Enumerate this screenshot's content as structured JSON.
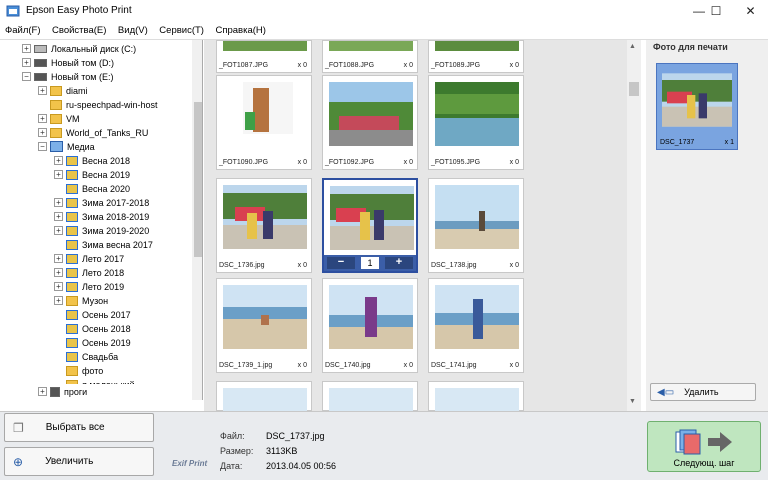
{
  "window": {
    "title": "Epson Easy Photo Print",
    "minimize": "—",
    "maximize": "☐",
    "close": "✕"
  },
  "menu": [
    "Файл(F)",
    "Свойства(E)",
    "Вид(V)",
    "Сервис(T)",
    "Справка(H)"
  ],
  "tree": [
    {
      "label": "Локальный диск (C:)",
      "icon": "drive-icon"
    },
    {
      "label": "Новый том (D:)",
      "icon": "drive-icon"
    },
    {
      "label": "Новый том (E:)",
      "icon": "drive-icon"
    },
    {
      "label": "diami",
      "icon": "folder-icon"
    },
    {
      "label": "ru-speechpad-win-host",
      "icon": "folder-icon"
    },
    {
      "label": "VM",
      "icon": "folder-icon"
    },
    {
      "label": "World_of_Tanks_RU",
      "icon": "folder-icon"
    },
    {
      "label": "Медиа",
      "icon": "media-folder-icon"
    },
    {
      "label": "Весна 2018",
      "icon": "folder-icon"
    },
    {
      "label": "Весна 2019",
      "icon": "folder-icon"
    },
    {
      "label": "Весна 2020",
      "icon": "folder-icon"
    },
    {
      "label": "Зима 2017-2018",
      "icon": "folder-icon"
    },
    {
      "label": "Зима 2018-2019",
      "icon": "folder-icon"
    },
    {
      "label": "Зима 2019-2020",
      "icon": "folder-icon"
    },
    {
      "label": "Зима весна 2017",
      "icon": "folder-icon"
    },
    {
      "label": "Лето 2017",
      "icon": "folder-icon"
    },
    {
      "label": "Лето 2018",
      "icon": "folder-icon"
    },
    {
      "label": "Лето 2019",
      "icon": "folder-icon"
    },
    {
      "label": "Музон",
      "icon": "folder-icon"
    },
    {
      "label": "Осень 2017",
      "icon": "folder-icon"
    },
    {
      "label": "Осень 2018",
      "icon": "folder-icon"
    },
    {
      "label": "Осень 2019",
      "icon": "folder-icon"
    },
    {
      "label": "Свадьба",
      "icon": "folder-icon"
    },
    {
      "label": "фото",
      "icon": "folder-icon"
    },
    {
      "label": "я маленький",
      "icon": "folder-icon"
    },
    {
      "label": "проги",
      "icon": "archive-icon"
    }
  ],
  "gallery": [
    {
      "name": "_FOT1087.JPG",
      "count": "x 0"
    },
    {
      "name": "_FOT1088.JPG",
      "count": "x 0"
    },
    {
      "name": "_FOT1089.JPG",
      "count": "x 0"
    },
    {
      "name": "_FOT1090.JPG",
      "count": "x 0"
    },
    {
      "name": "_FOT1092.JPG",
      "count": "x 0"
    },
    {
      "name": "_FOT1095.JPG",
      "count": "x 0"
    },
    {
      "name": "DSC_1736.jpg",
      "count": "x 0"
    },
    {
      "name": "DSC_1737",
      "count": "",
      "selected": true,
      "qty": "1",
      "minus": "−",
      "plus": "+"
    },
    {
      "name": "DSC_1738.jpg",
      "count": "x 0"
    },
    {
      "name": "DSC_1739_1.jpg",
      "count": "x 0"
    },
    {
      "name": "DSC_1740.jpg",
      "count": "x 0"
    },
    {
      "name": "DSC_1741.jpg",
      "count": "x 0"
    }
  ],
  "print_panel": {
    "title": "Фото для печати",
    "item_name": "DSC_1737",
    "item_count": "x 1",
    "delete_label": "Удалить"
  },
  "bottom": {
    "select_all": "Выбрать все",
    "zoom": "Увеличить",
    "logo": "Exif Print",
    "file_label": "Файл:",
    "file_value": "DSC_1737.jpg",
    "size_label": "Размер:",
    "size_value": "3113KB",
    "date_label": "Дата:",
    "date_value": "2013.04.05 00:56",
    "next": "Следующ. шаг"
  }
}
